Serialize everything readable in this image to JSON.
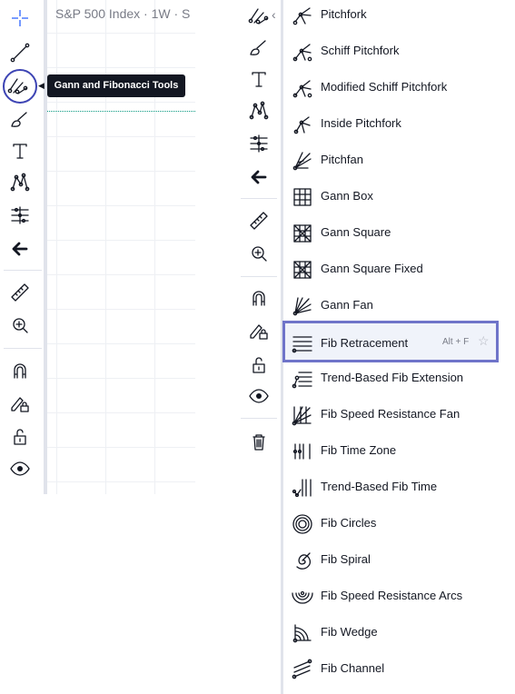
{
  "chart": {
    "title": "S&P 500 Index · 1W · S"
  },
  "tooltip": {
    "text": "Gann and Fibonacci Tools"
  },
  "left_toolbar": {
    "tools": [
      "crosshair-icon",
      "trend-line-icon",
      "gann-fib-tools-icon",
      "brush-icon",
      "text-icon",
      "patterns-icon",
      "prediction-icon",
      "back-arrow-icon",
      "ruler-icon",
      "zoom-in-icon",
      "magnet-icon",
      "lock-drawing-icon",
      "unlock-icon",
      "eye-icon"
    ]
  },
  "right_toolbar": {
    "tools": [
      "gann-fib-tools-icon",
      "brush-icon",
      "text-icon",
      "patterns-icon",
      "prediction-icon",
      "back-arrow-icon",
      "ruler-icon",
      "zoom-in-icon",
      "magnet-icon",
      "lock-drawing-icon",
      "unlock-icon",
      "eye-icon",
      "trash-icon"
    ]
  },
  "menu": {
    "items": [
      {
        "label": "Pitchfork",
        "icon": "pitchfork-icon"
      },
      {
        "label": "Schiff Pitchfork",
        "icon": "schiff-pitchfork-icon"
      },
      {
        "label": "Modified Schiff Pitchfork",
        "icon": "modified-schiff-pitchfork-icon"
      },
      {
        "label": "Inside Pitchfork",
        "icon": "inside-pitchfork-icon"
      },
      {
        "label": "Pitchfan",
        "icon": "pitchfan-icon"
      },
      {
        "label": "Gann Box",
        "icon": "gann-box-icon"
      },
      {
        "label": "Gann Square",
        "icon": "gann-square-icon"
      },
      {
        "label": "Gann Square Fixed",
        "icon": "gann-square-fixed-icon"
      },
      {
        "label": "Gann Fan",
        "icon": "gann-fan-icon"
      },
      {
        "label": "Fib Retracement",
        "icon": "fib-retracement-icon",
        "shortcut": "Alt + F"
      },
      {
        "label": "Trend-Based Fib Extension",
        "icon": "trend-based-fib-extension-icon"
      },
      {
        "label": "Fib Speed Resistance Fan",
        "icon": "fib-speed-resistance-fan-icon"
      },
      {
        "label": "Fib Time Zone",
        "icon": "fib-time-zone-icon"
      },
      {
        "label": "Trend-Based Fib Time",
        "icon": "trend-based-fib-time-icon"
      },
      {
        "label": "Fib Circles",
        "icon": "fib-circles-icon"
      },
      {
        "label": "Fib Spiral",
        "icon": "fib-spiral-icon"
      },
      {
        "label": "Fib Speed Resistance Arcs",
        "icon": "fib-speed-resistance-arcs-icon"
      },
      {
        "label": "Fib Wedge",
        "icon": "fib-wedge-icon"
      },
      {
        "label": "Fib Channel",
        "icon": "fib-channel-icon"
      }
    ]
  },
  "colors": {
    "highlight": "#3d44b4",
    "active_border": "#6f74c9",
    "active_bg": "#f0f3fa",
    "crosshair": "#2962ff",
    "dotted_line": "#089981"
  }
}
